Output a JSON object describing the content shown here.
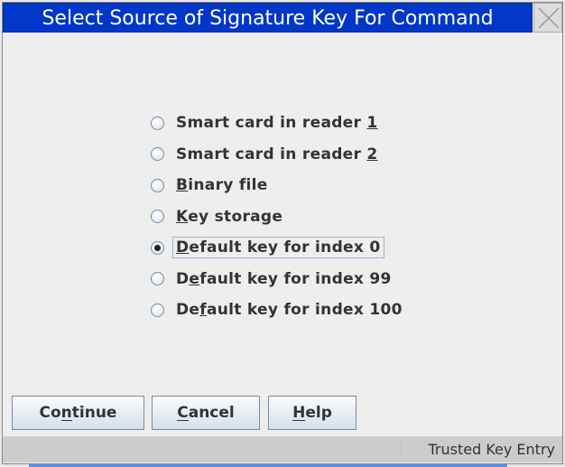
{
  "dialog": {
    "title": "Select Source of Signature Key For Command"
  },
  "options": [
    {
      "label": "Smart card in reader 1",
      "mnemonic_index": 21,
      "selected": false
    },
    {
      "label": "Smart card in reader 2",
      "mnemonic_index": 21,
      "selected": false
    },
    {
      "label": "Binary file",
      "mnemonic_index": 0,
      "selected": false
    },
    {
      "label": "Key storage",
      "mnemonic_index": 0,
      "selected": false
    },
    {
      "label": "Default key for index 0",
      "mnemonic_index": 0,
      "selected": true
    },
    {
      "label": "Default key for index 99",
      "mnemonic_index": 1,
      "selected": false
    },
    {
      "label": "Default key for index 100",
      "mnemonic_index": 2,
      "selected": false
    }
  ],
  "buttons": [
    {
      "label": "Continue",
      "mnemonic_index": 2
    },
    {
      "label": "Cancel",
      "mnemonic_index": 0
    },
    {
      "label": "Help",
      "mnemonic_index": 0
    }
  ],
  "status": {
    "text": "Trusted Key Entry"
  },
  "colors": {
    "titlebar": "#0037c8"
  }
}
